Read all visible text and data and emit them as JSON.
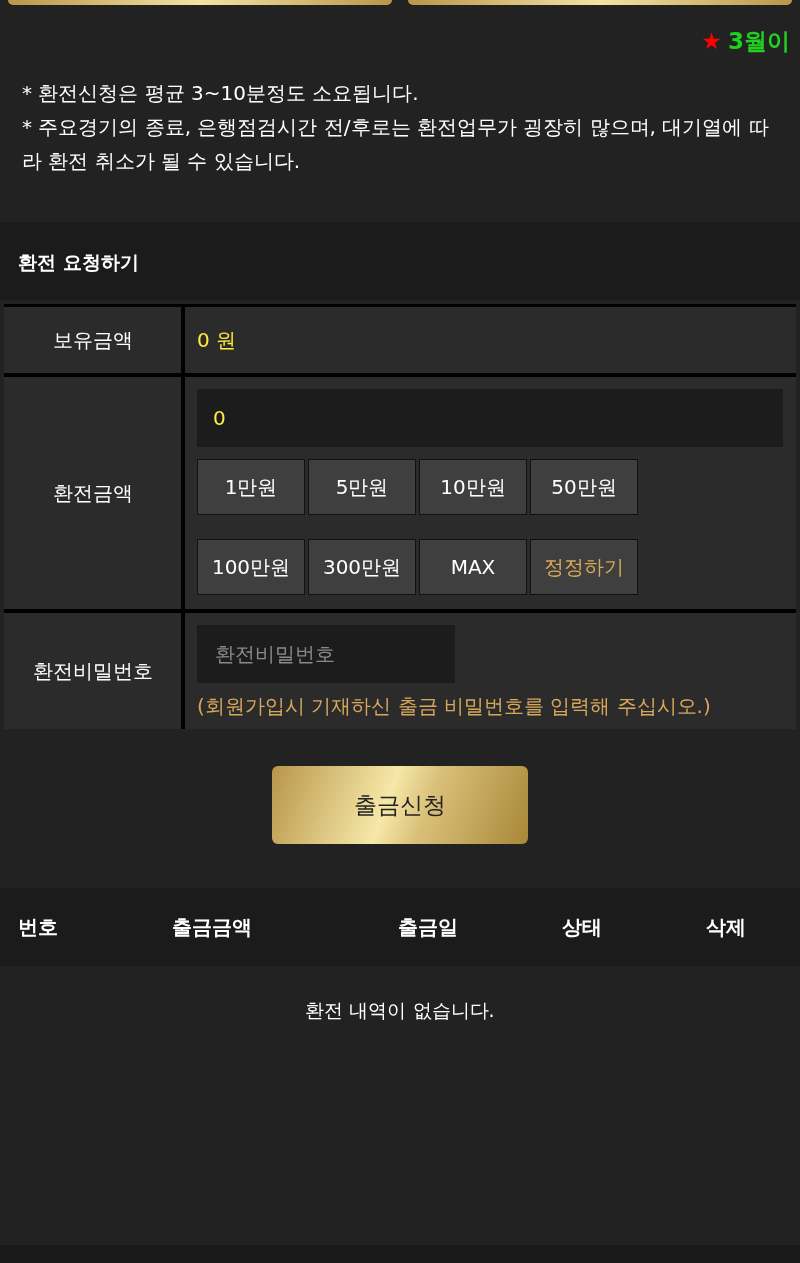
{
  "ticker": {
    "star": "★",
    "text": "3월이"
  },
  "notice": {
    "lines": [
      "* 환전신청은 평균 3~10분정도 소요됩니다.",
      "* 주요경기의 종료, 은행점검시간 전/후로는 환전업무가 굉장히 많으며, 대기열에 따라 환전 취소가 될 수 있습니다."
    ]
  },
  "section_title": "환전 요청하기",
  "form": {
    "balance_label": "보유금액",
    "balance_value": "0 원",
    "amount_label": "환전금액",
    "amount_value": "0",
    "amount_buttons": [
      {
        "label": "1만원",
        "kind": "add"
      },
      {
        "label": "5만원",
        "kind": "add"
      },
      {
        "label": "10만원",
        "kind": "add"
      },
      {
        "label": "50만원",
        "kind": "add"
      },
      {
        "label": "100만원",
        "kind": "add"
      },
      {
        "label": "300만원",
        "kind": "add"
      },
      {
        "label": "MAX",
        "kind": "add"
      },
      {
        "label": "정정하기",
        "kind": "reset"
      }
    ],
    "password_label": "환전비밀번호",
    "password_placeholder": "환전비밀번호",
    "password_hint": "(회원가입시 기재하신 출금 비밀번호를 입력해 주십시오.)"
  },
  "submit": "출금신청",
  "history": {
    "columns": [
      "번호",
      "출금금액",
      "출금일",
      "상태",
      "삭제"
    ],
    "empty": "환전 내역이 없습니다."
  }
}
